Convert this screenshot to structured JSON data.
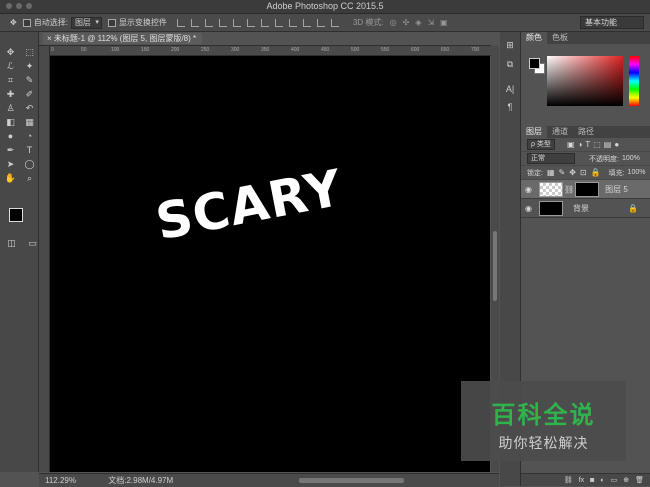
{
  "window": {
    "title": "Adobe Photoshop CC 2015.5"
  },
  "options": {
    "auto_select_label": "自动选择:",
    "auto_select_value": "图层",
    "show_transform_label": "显示变换控件",
    "mode_3d": "3D 模式:",
    "workspace": "基本功能"
  },
  "document": {
    "tab_label": "未标题-1 @ 112% (图层 5, 图层蒙版/8) *",
    "canvas_text": "SCARY",
    "ruler_ticks": [
      "0",
      "50",
      "100",
      "150",
      "200",
      "250",
      "300",
      "350",
      "400",
      "450",
      "500",
      "550",
      "600",
      "650",
      "700"
    ]
  },
  "status": {
    "zoom": "112.29%",
    "doc_info": "文档:2.98M/4.97M"
  },
  "panels": {
    "color_tabs": [
      "颜色",
      "色板"
    ],
    "layers_tabs": [
      "图层",
      "通道",
      "路径"
    ],
    "filter_kind": "ρ 类型",
    "blend_mode": "正常",
    "opacity_label": "不透明度:",
    "opacity_value": "100%",
    "lock_label": "锁定:",
    "fill_label": "填充:",
    "fill_value": "100%",
    "layers": [
      {
        "name": "图层 5",
        "active": true
      },
      {
        "name": "背景",
        "active": false
      }
    ],
    "bottom_icons": [
      "fx"
    ]
  },
  "watermark": {
    "title": "百科全说",
    "subtitle": "助你轻松解决"
  },
  "colors": {
    "canvas": "#000000",
    "watermark_green": "#2fb34a",
    "ui_bg": "#535353"
  }
}
